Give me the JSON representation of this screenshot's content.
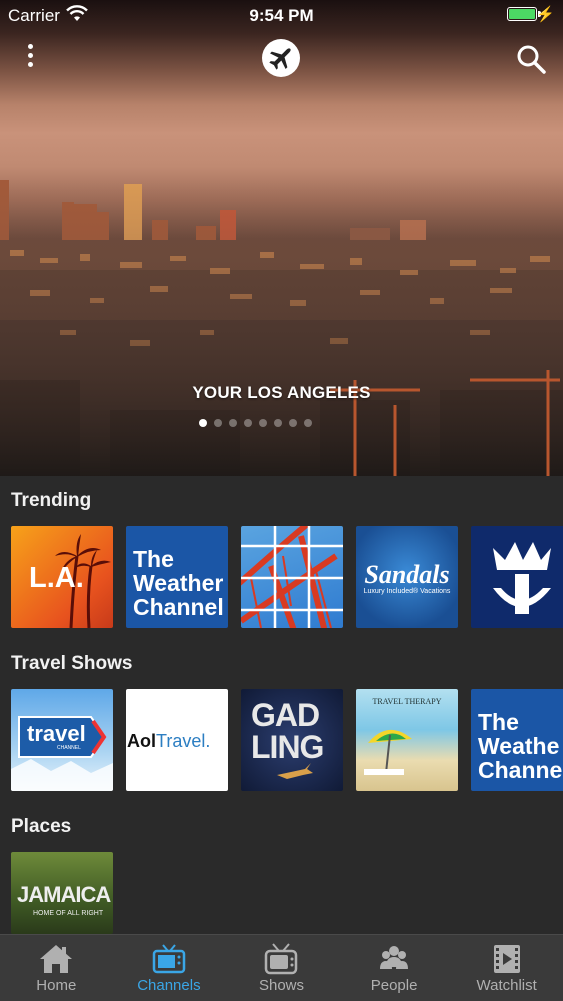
{
  "status": {
    "carrier": "Carrier",
    "time": "9:54 PM"
  },
  "hero": {
    "title": "YOUR LOS ANGELES",
    "page_count": 8,
    "active_page": 1
  },
  "sections": [
    {
      "title": "Trending",
      "items": [
        {
          "name": "L.A.",
          "text": "L.A."
        },
        {
          "name": "The Weather Channel",
          "text": [
            "The",
            "Weather",
            "Channel"
          ]
        },
        {
          "name": "Golden Gate Bridge",
          "text": ""
        },
        {
          "name": "Sandals",
          "text": "Sandals",
          "subtext": "Luxury Included® Vacations"
        },
        {
          "name": "Royal Caribbean",
          "text": ""
        }
      ]
    },
    {
      "title": "Travel Shows",
      "items": [
        {
          "name": "Travel Channel",
          "text": "travel",
          "subtext": "CHANNEL"
        },
        {
          "name": "Aol Travel",
          "text1": "Aol",
          "text2": "Travel."
        },
        {
          "name": "Gadling",
          "text1": "GAD",
          "text2": "LING"
        },
        {
          "name": "Travel Therapy",
          "text": "TRAVEL THERAPY"
        },
        {
          "name": "The Weather Channel",
          "text": [
            "The",
            "Weathe",
            "Channe"
          ]
        }
      ]
    },
    {
      "title": "Places",
      "items": [
        {
          "name": "Jamaica",
          "text": "JAMAICA",
          "subtext": "HOME OF ALL RIGHT"
        }
      ]
    }
  ],
  "tabs": [
    {
      "label": "Home",
      "icon": "home-icon",
      "active": false
    },
    {
      "label": "Channels",
      "icon": "tv-icon",
      "active": true
    },
    {
      "label": "Shows",
      "icon": "tv-antenna-icon",
      "active": false
    },
    {
      "label": "People",
      "icon": "people-icon",
      "active": false
    },
    {
      "label": "Watchlist",
      "icon": "film-icon",
      "active": false
    }
  ],
  "colors": {
    "accent": "#3aa6e6",
    "tab_inactive": "#b0b0b0",
    "background": "#2a2a2a",
    "battery": "#4cd964"
  }
}
